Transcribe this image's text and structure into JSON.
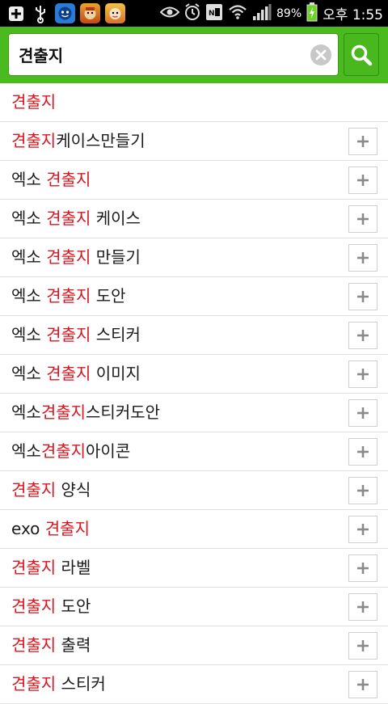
{
  "status_bar": {
    "battery": "89%",
    "time": "오후 1:55",
    "left_icons": [
      "add-icon",
      "usb-icon",
      "app-icon-blue",
      "app-icon-game-1",
      "app-icon-game-2"
    ],
    "right_icons": [
      "eye-icon",
      "alarm-icon",
      "nfc-icon",
      "wifi-icon",
      "signal-icon",
      "battery-icon"
    ]
  },
  "search": {
    "value": "견출지",
    "clear_icon": "clear-icon",
    "search_icon": "search-icon"
  },
  "colors": {
    "accent": "#4bba1e",
    "highlight": "#d8141e"
  },
  "suggestions": [
    {
      "parts": [
        "",
        "견출지",
        ""
      ],
      "has_add": false
    },
    {
      "parts": [
        "",
        "견출지",
        "케이스만들기"
      ],
      "has_add": true
    },
    {
      "parts": [
        "엑소 ",
        "견출지",
        ""
      ],
      "has_add": true
    },
    {
      "parts": [
        "엑소 ",
        "견출지",
        " 케이스"
      ],
      "has_add": true
    },
    {
      "parts": [
        "엑소 ",
        "견출지",
        " 만들기"
      ],
      "has_add": true
    },
    {
      "parts": [
        "엑소 ",
        "견출지",
        " 도안"
      ],
      "has_add": true
    },
    {
      "parts": [
        "엑소 ",
        "견출지",
        " 스티커"
      ],
      "has_add": true
    },
    {
      "parts": [
        "엑소 ",
        "견출지",
        " 이미지"
      ],
      "has_add": true
    },
    {
      "parts": [
        "엑소",
        "견출지",
        "스티커도안"
      ],
      "has_add": true
    },
    {
      "parts": [
        "엑소",
        "견출지",
        "아이콘"
      ],
      "has_add": true
    },
    {
      "parts": [
        "",
        "견출지",
        " 양식"
      ],
      "has_add": true
    },
    {
      "parts": [
        "exo ",
        "견출지",
        ""
      ],
      "has_add": true
    },
    {
      "parts": [
        "",
        "견출지",
        " 라벨"
      ],
      "has_add": true
    },
    {
      "parts": [
        "",
        "견출지",
        " 도안"
      ],
      "has_add": true
    },
    {
      "parts": [
        "",
        "견출지",
        " 출력"
      ],
      "has_add": true
    },
    {
      "parts": [
        "",
        "견출지",
        " 스티커"
      ],
      "has_add": true
    }
  ]
}
